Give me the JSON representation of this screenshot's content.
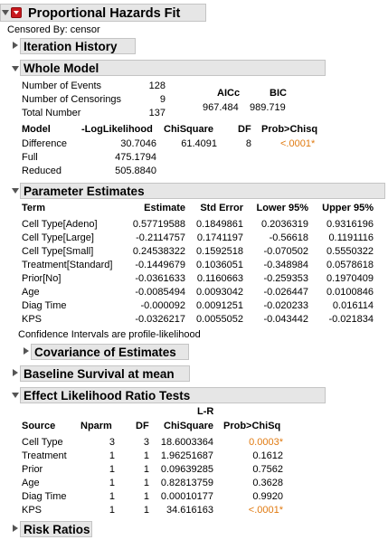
{
  "report": {
    "title": "Proportional Hazards Fit",
    "censored_by": "Censored By: censor"
  },
  "outline": {
    "iteration_history": "Iteration History",
    "whole_model": "Whole Model",
    "parameter_estimates": "Parameter Estimates",
    "covariance": "Covariance of Estimates",
    "baseline": "Baseline Survival at mean",
    "effect_lr": "Effect Likelihood Ratio Tests",
    "risk_ratios": "Risk Ratios"
  },
  "whole_model": {
    "counts": [
      {
        "label": "Number of Events",
        "value": "128"
      },
      {
        "label": "Number of Censorings",
        "value": "9"
      },
      {
        "label": "Total Number",
        "value": "137"
      }
    ],
    "aicc_label": "AICc",
    "aicc": "967.484",
    "bic_label": "BIC",
    "bic": "989.719",
    "table_headers": [
      "Model",
      "-LogLikelihood",
      "ChiSquare",
      "DF",
      "Prob>Chisq"
    ],
    "rows": [
      {
        "model": "Difference",
        "loglik": "30.7046",
        "chisq": "61.4091",
        "df": "8",
        "prob": "<.0001*"
      },
      {
        "model": "Full",
        "loglik": "475.1794",
        "chisq": "",
        "df": "",
        "prob": ""
      },
      {
        "model": "Reduced",
        "loglik": "505.8840",
        "chisq": "",
        "df": "",
        "prob": ""
      }
    ]
  },
  "parameter_estimates": {
    "headers": [
      "Term",
      "Estimate",
      "Std Error",
      "Lower 95%",
      "Upper 95%"
    ],
    "rows": [
      {
        "term": "Cell Type[Adeno]",
        "est": "0.57719588",
        "se": "0.1849861",
        "lo": "0.2036319",
        "hi": "0.9316196"
      },
      {
        "term": "Cell Type[Large]",
        "est": "-0.2114757",
        "se": "0.1741197",
        "lo": "-0.56618",
        "hi": "0.1191116"
      },
      {
        "term": "Cell Type[Small]",
        "est": "0.24538322",
        "se": "0.1592518",
        "lo": "-0.070502",
        "hi": "0.5550322"
      },
      {
        "term": "Treatment[Standard]",
        "est": "-0.1449679",
        "se": "0.1036051",
        "lo": "-0.348984",
        "hi": "0.0578618"
      },
      {
        "term": "Prior[No]",
        "est": "-0.0361633",
        "se": "0.1160663",
        "lo": "-0.259353",
        "hi": "0.1970409"
      },
      {
        "term": "Age",
        "est": "-0.0085494",
        "se": "0.0093042",
        "lo": "-0.026447",
        "hi": "0.0100846"
      },
      {
        "term": "Diag Time",
        "est": "-0.000092",
        "se": "0.0091251",
        "lo": "-0.020233",
        "hi": "0.016114"
      },
      {
        "term": "KPS",
        "est": "-0.0326217",
        "se": "0.0055052",
        "lo": "-0.043442",
        "hi": "-0.021834"
      }
    ],
    "note": "Confidence Intervals are profile-likelihood"
  },
  "effect_lr": {
    "header_top": "L-R",
    "headers": [
      "Source",
      "Nparm",
      "DF",
      "ChiSquare",
      "Prob>ChiSq"
    ],
    "rows": [
      {
        "source": "Cell Type",
        "nparm": "3",
        "df": "3",
        "chisq": "18.6003364",
        "prob": "0.0003*",
        "sig": true
      },
      {
        "source": "Treatment",
        "nparm": "1",
        "df": "1",
        "chisq": "1.96251687",
        "prob": "0.1612",
        "sig": false
      },
      {
        "source": "Prior",
        "nparm": "1",
        "df": "1",
        "chisq": "0.09639285",
        "prob": "0.7562",
        "sig": false
      },
      {
        "source": "Age",
        "nparm": "1",
        "df": "1",
        "chisq": "0.82813759",
        "prob": "0.3628",
        "sig": false
      },
      {
        "source": "Diag Time",
        "nparm": "1",
        "df": "1",
        "chisq": "0.00010177",
        "prob": "0.9920",
        "sig": false
      },
      {
        "source": "KPS",
        "nparm": "1",
        "df": "1",
        "chisq": "34.616163",
        "prob": "<.0001*",
        "sig": true
      }
    ]
  }
}
